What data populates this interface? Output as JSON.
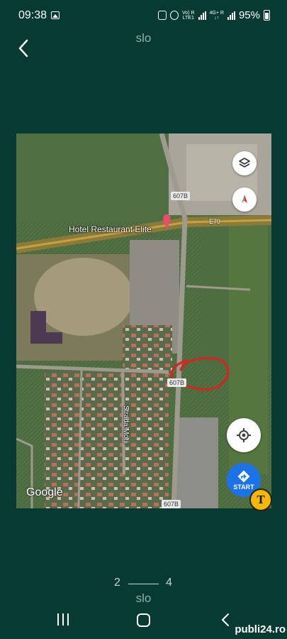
{
  "status_bar": {
    "time": "09:38",
    "network_top": "Vo) R",
    "network_bottom": "LTE1",
    "data_top": "4G+ R",
    "data_bottom": "↓↑",
    "battery": "95%"
  },
  "header": {
    "title": "slo"
  },
  "map": {
    "place_label": "Hotel Restaurant Elite",
    "road_badges": [
      "607B",
      "E70",
      "607B",
      "607B"
    ],
    "street_label": "Strada Morii",
    "logo": "Google",
    "start_label": "START",
    "icons": [
      "layers-icon",
      "compass-icon",
      "my-location-icon",
      "directions-icon",
      "hotel-pin-icon"
    ],
    "annotation_color": "#e02020"
  },
  "pager": {
    "current": "2",
    "total": "4"
  },
  "footer": {
    "title": "slo",
    "watermark": "publi24.ro"
  },
  "colors": {
    "background": "#063a33",
    "accent": "#1a73e8",
    "toggle": "#f5b800"
  }
}
